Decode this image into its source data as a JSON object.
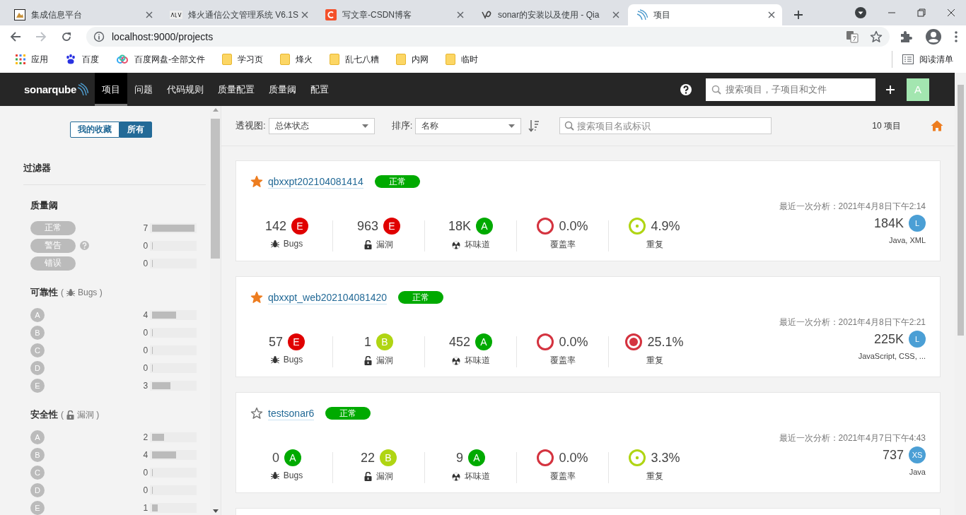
{
  "browser": {
    "tabs": [
      {
        "title": "集成信息平台",
        "selected": false
      },
      {
        "title": "烽火通信公文管理系统 V6.1S",
        "selected": false
      },
      {
        "title": "写文章-CSDN博客",
        "selected": false
      },
      {
        "title": "sonar的安装以及使用 - Qia",
        "selected": false
      },
      {
        "title": "项目",
        "selected": true
      }
    ],
    "address": "localhost:9000/projects",
    "bookmarks": [
      {
        "label": "应用",
        "kind": "apps"
      },
      {
        "label": "百度",
        "kind": "paw"
      },
      {
        "label": "百度网盘-全部文件",
        "kind": "cloud"
      },
      {
        "label": "学习页",
        "kind": "folder"
      },
      {
        "label": "烽火",
        "kind": "folder"
      },
      {
        "label": "乱七八糟",
        "kind": "folder"
      },
      {
        "label": "内网",
        "kind": "folder"
      },
      {
        "label": "临时",
        "kind": "folder"
      }
    ],
    "reading_list": "阅读清单"
  },
  "nav": {
    "logo": "sonarqube",
    "items": [
      {
        "label": "项目",
        "selected": true
      },
      {
        "label": "问题",
        "selected": false
      },
      {
        "label": "代码规则",
        "selected": false
      },
      {
        "label": "质量配置",
        "selected": false
      },
      {
        "label": "质量阈",
        "selected": false
      },
      {
        "label": "配置",
        "selected": false
      }
    ],
    "search": {
      "placeholder": "搜索项目，子项目和文件"
    },
    "avatar": "A"
  },
  "sidebar": {
    "toggle": [
      {
        "label": "我的收藏",
        "selected": false
      },
      {
        "label": "所有",
        "selected": true
      }
    ],
    "title": "过滤器",
    "facets": [
      {
        "kind": "gate",
        "title": "质量阈",
        "options": [
          {
            "label": "正常",
            "count": "7",
            "level": 1,
            "help": false
          },
          {
            "label": "警告",
            "count": "0",
            "level": 0,
            "help": true
          },
          {
            "label": "错误",
            "count": "0",
            "level": 0,
            "help": false
          }
        ]
      },
      {
        "kind": "rating",
        "title": "可靠性",
        "metric": {
          "kind": "bugs",
          "prefix": "(",
          "label": "Bugs )"
        },
        "options": [
          {
            "label": "A",
            "count": "4",
            "level": 0.57
          },
          {
            "label": "B",
            "count": "0",
            "level": 0
          },
          {
            "label": "C",
            "count": "0",
            "level": 0
          },
          {
            "label": "D",
            "count": "0",
            "level": 0
          },
          {
            "label": "E",
            "count": "3",
            "level": 0.43
          }
        ]
      },
      {
        "kind": "rating",
        "title": "安全性",
        "metric": {
          "kind": "vulnerabilities",
          "prefix": "(",
          "label": "漏洞 )"
        },
        "options": [
          {
            "label": "A",
            "count": "2",
            "level": 0.29
          },
          {
            "label": "B",
            "count": "4",
            "level": 0.57
          },
          {
            "label": "C",
            "count": "0",
            "level": 0
          },
          {
            "label": "D",
            "count": "0",
            "level": 0
          },
          {
            "label": "E",
            "count": "1",
            "level": 0.14
          }
        ]
      }
    ]
  },
  "toolbar": {
    "perspective": {
      "label": "透视图:",
      "value": "总体状态"
    },
    "sort": {
      "label": "排序:",
      "value": "名称"
    },
    "search": {
      "placeholder": "搜索项目名或标识"
    },
    "count": "10 项目"
  },
  "projects": [
    {
      "name": "qbxxpt202104081414",
      "starred": true,
      "gate": "正常",
      "analysis": "最近一次分析：2021年4月8日下午2:14",
      "bugs": {
        "value": "142",
        "rating": "E",
        "label": "Bugs"
      },
      "vulnerabilities": {
        "value": "963",
        "rating": "E",
        "label": "漏洞"
      },
      "code_smells": {
        "value": "18K",
        "rating": "A",
        "label": "坏味道"
      },
      "coverage": {
        "value": "0.0%",
        "color": "#d4333f",
        "label": "覆盖率"
      },
      "duplications": {
        "value": "4.9%",
        "color": "#b0d513",
        "kind": "dot",
        "label": "重复"
      },
      "size": {
        "value": "184K",
        "rating": "L",
        "languages": "Java, XML"
      }
    },
    {
      "name": "qbxxpt_web202104081420",
      "starred": true,
      "gate": "正常",
      "analysis": "最近一次分析：2021年4月8日下午2:21",
      "bugs": {
        "value": "57",
        "rating": "E",
        "label": "Bugs"
      },
      "vulnerabilities": {
        "value": "1",
        "rating": "B",
        "label": "漏洞"
      },
      "code_smells": {
        "value": "452",
        "rating": "A",
        "label": "坏味道"
      },
      "coverage": {
        "value": "0.0%",
        "color": "#d4333f",
        "label": "覆盖率"
      },
      "duplications": {
        "value": "25.1%",
        "color": "#d4333f",
        "kind": "disc",
        "label": "重复"
      },
      "size": {
        "value": "225K",
        "rating": "L",
        "languages": "JavaScript, CSS, ..."
      }
    },
    {
      "name": "testsonar6",
      "starred": false,
      "gate": "正常",
      "analysis": "最近一次分析：2021年4月7日下午4:43",
      "bugs": {
        "value": "0",
        "rating": "A",
        "label": "Bugs"
      },
      "vulnerabilities": {
        "value": "22",
        "rating": "B",
        "label": "漏洞"
      },
      "code_smells": {
        "value": "9",
        "rating": "A",
        "label": "坏味道"
      },
      "coverage": {
        "value": "0.0%",
        "color": "#d4333f",
        "label": "覆盖率"
      },
      "duplications": {
        "value": "3.3%",
        "color": "#b0d513",
        "kind": "dot",
        "label": "重复"
      },
      "size": {
        "value": "737",
        "rating": "XS",
        "languages": "Java"
      }
    }
  ]
}
